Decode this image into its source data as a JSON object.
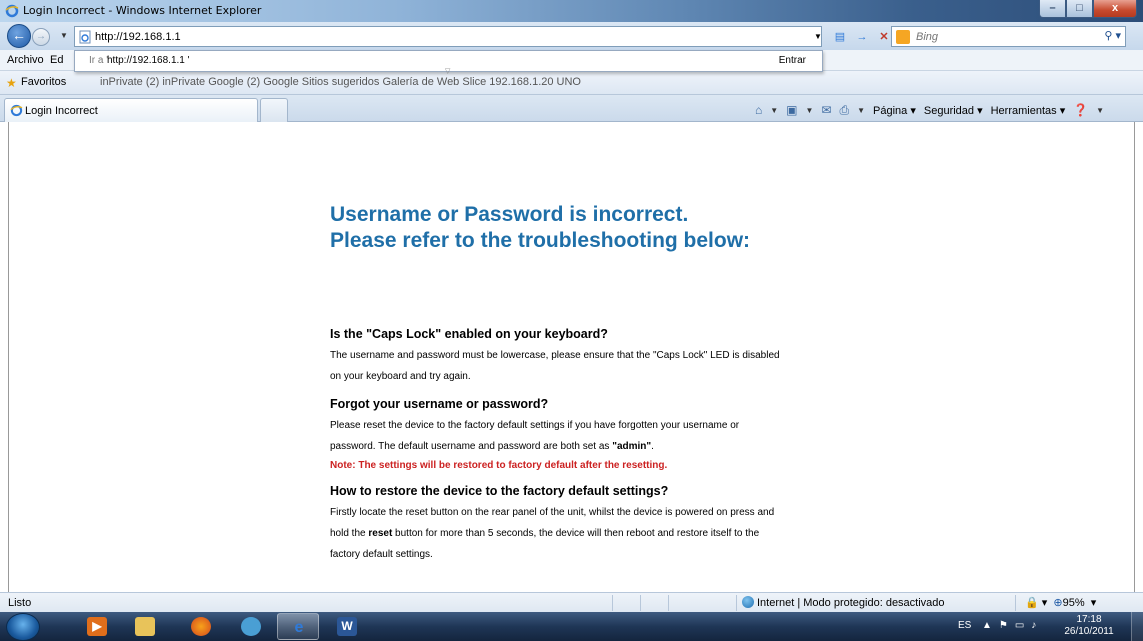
{
  "window": {
    "title": "Login Incorrect - Windows Internet Explorer",
    "controls": {
      "minimize": "–",
      "maximize": "□",
      "close": "x"
    }
  },
  "nav": {
    "address_value": "http://192.168.1.1",
    "search_placeholder": "Bing"
  },
  "autocomplete": {
    "prefix": "Ir a '",
    "url": "http://192.168.1.1 '",
    "go_label": "Entrar"
  },
  "menu": {
    "items": [
      "Archivo",
      "Ed"
    ]
  },
  "favorites": {
    "label": "Favoritos",
    "links_text": "inPrivate (2)    inPrivate    Google (2)    Google    Sitios sugeridos    Galería de Web Slice    192.168.1.20    UNO"
  },
  "tab": {
    "label": "Login Incorrect"
  },
  "commandbar": {
    "page": "Página",
    "safety": "Seguridad",
    "tools": "Herramientas"
  },
  "page": {
    "title_line1": "Username or Password is incorrect.",
    "title_line2": "Please refer to the troubleshooting below:",
    "sections": [
      {
        "heading": "Is the \"Caps Lock\" enabled on your keyboard?",
        "line1": "The username and password must be lowercase, please ensure that the \"Caps Lock\" LED is disabled",
        "line2": "on your keyboard and try again."
      },
      {
        "heading": "Forgot your username or password?",
        "line1": "Please reset the device to the factory default settings if you have forgotten your username or",
        "line2_pre": "password. The default username and password are both set as ",
        "line2_bold": "\"admin\"",
        "line2_post": ".",
        "note": "Note: The settings will be restored to factory default after the resetting."
      },
      {
        "heading": "How to restore the device to the factory default settings?",
        "line1": "Firstly locate the reset button on the rear panel of the unit, whilst the device is powered on press and",
        "line2_pre": "hold the ",
        "line2_bold": "reset",
        "line2_post": " button for more than 5 seconds, the device will then reboot and restore itself to the",
        "line3": "factory default settings."
      }
    ]
  },
  "status": {
    "left": "Listo",
    "zone": "Internet | Modo protegido: desactivado",
    "zoom": "95%"
  },
  "taskbar": {
    "lang": "ES",
    "time": "17:18",
    "date": "26/10/2011"
  },
  "colors": {
    "title_blue": "#1f6fa8",
    "note_red": "#cc2222"
  }
}
